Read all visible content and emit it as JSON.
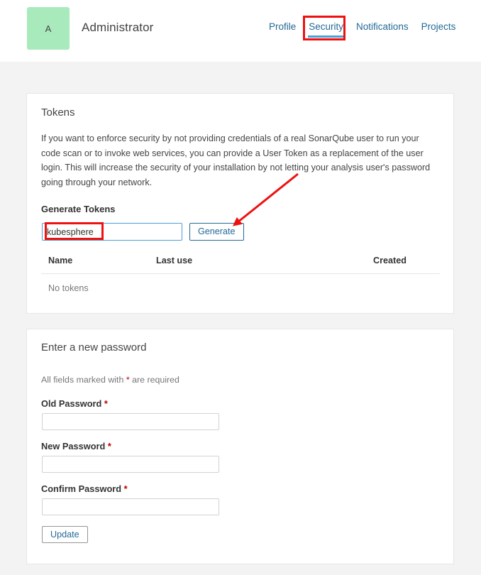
{
  "header": {
    "avatar_letter": "A",
    "user_name": "Administrator",
    "tabs": [
      {
        "label": "Profile",
        "active": false
      },
      {
        "label": "Security",
        "active": true
      },
      {
        "label": "Notifications",
        "active": false
      },
      {
        "label": "Projects",
        "active": false
      }
    ]
  },
  "tokens_card": {
    "title": "Tokens",
    "description": "If you want to enforce security by not providing credentials of a real SonarQube user to run your code scan or to invoke web services, you can provide a User Token as a replacement of the user login. This will increase the security of your installation by not letting your analysis user's password going through your network.",
    "generate_label": "Generate Tokens",
    "token_input_value": "kubesphere",
    "token_input_placeholder": "",
    "generate_button": "Generate",
    "table": {
      "columns": [
        "Name",
        "Last use",
        "Created"
      ],
      "rows": [],
      "empty_text": "No tokens"
    }
  },
  "password_card": {
    "title": "Enter a new password",
    "required_note_prefix": "All fields marked with ",
    "required_note_star": "*",
    "required_note_suffix": " are required",
    "fields": [
      {
        "label": "Old Password",
        "required": "*",
        "value": "",
        "placeholder": ""
      },
      {
        "label": "New Password",
        "required": "*",
        "value": "",
        "placeholder": ""
      },
      {
        "label": "Confirm Password",
        "required": "*",
        "value": "",
        "placeholder": ""
      }
    ],
    "update_button": "Update"
  },
  "annotations": {
    "security_tab_highlight_color": "#ee1111",
    "token_input_highlight_color": "#ee1111",
    "arrow_color": "#ee1111"
  },
  "colors": {
    "page_background": "#f3f3f3",
    "card_background": "#ffffff",
    "avatar_background": "#a8eabb",
    "link_blue": "#236a97",
    "active_tab_underline": "#4b9fd5",
    "required_red": "#b00000"
  }
}
